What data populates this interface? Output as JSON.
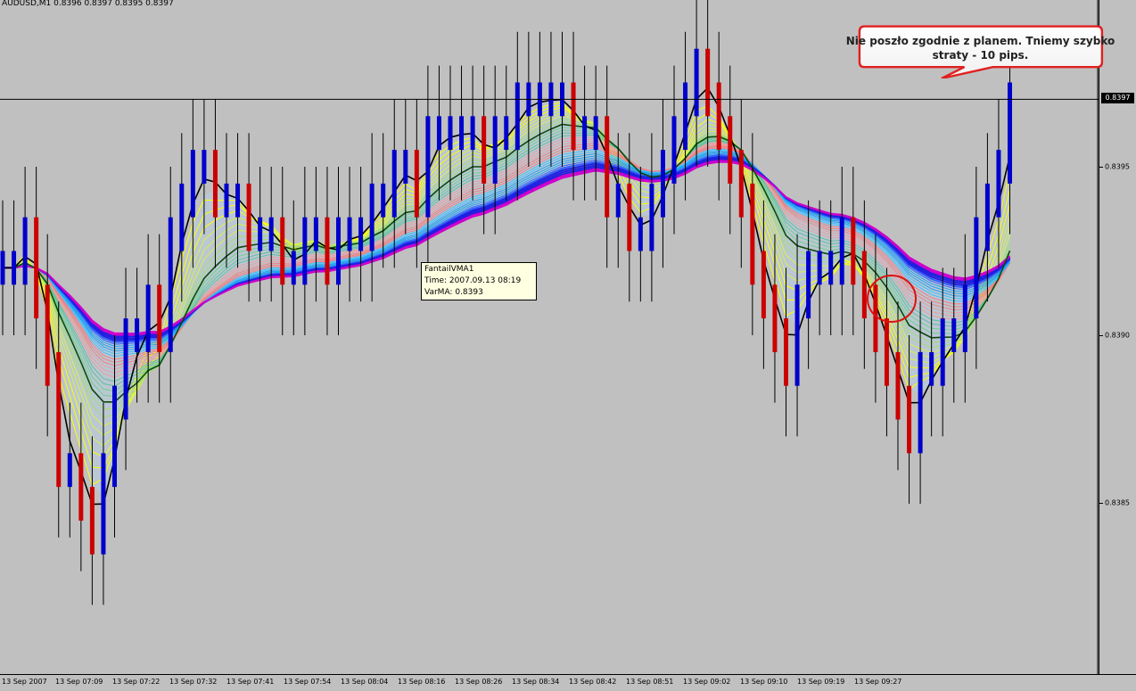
{
  "window": {
    "symbol_header": "AUDUSD,M1  0.8396 0.8397 0.8395 0.8397"
  },
  "price_scale": {
    "labels": [
      "0.8395",
      "0.8390",
      "0.8385"
    ],
    "current_price": "0.8397"
  },
  "time_axis": {
    "labels": [
      "13 Sep 2007",
      "13 Sep 07:09",
      "13 Sep 07:22",
      "13 Sep 07:32",
      "13 Sep 07:41",
      "13 Sep 07:54",
      "13 Sep 08:04",
      "13 Sep 08:16",
      "13 Sep 08:26",
      "13 Sep 08:34",
      "13 Sep 08:42",
      "13 Sep 08:51",
      "13 Sep 09:02",
      "13 Sep 09:10",
      "13 Sep 09:19",
      "13 Sep 09:27"
    ]
  },
  "tooltip": {
    "name": "FantailVMA1",
    "time": "Time: 2007.09.13 08:19",
    "value": "VarMA: 0.8393"
  },
  "callout": {
    "text": "Nie poszło zgodnie z planem. Tniemy szybko straty - 10 pips."
  },
  "colors": {
    "background": "#c0c0c0",
    "bull_candle": "#0000cc",
    "bear_candle": "#cc0000",
    "callout_border": "#e02020",
    "highlight_circle": "#dd1111"
  },
  "chart_data": {
    "type": "candlestick",
    "symbol": "AUDUSD",
    "timeframe": "M1",
    "ylim": [
      0.838,
      0.8399
    ],
    "current_price": 0.8397,
    "series": [
      {
        "closes": [
          0.8392,
          0.8392,
          0.8393,
          0.8391,
          0.8389,
          0.8386,
          0.8386,
          0.8385,
          0.8384,
          0.8386,
          0.8388,
          0.839,
          0.839,
          0.8391,
          0.839,
          0.8393,
          0.8394,
          0.8395,
          0.8395,
          0.8394,
          0.8394,
          0.8394,
          0.8393,
          0.8393,
          0.8393,
          0.8392,
          0.8392,
          0.8393,
          0.8393,
          0.8392,
          0.8393,
          0.8393,
          0.8393,
          0.8394,
          0.8394,
          0.8395,
          0.8395,
          0.8394,
          0.8396,
          0.8396,
          0.8396,
          0.8396,
          0.8396,
          0.8395,
          0.8396,
          0.8396,
          0.8397,
          0.8397,
          0.8397,
          0.8397,
          0.8397,
          0.8396,
          0.8396,
          0.8396,
          0.8394,
          0.8394,
          0.8393,
          0.8393,
          0.8394,
          0.8395,
          0.8396,
          0.8397,
          0.8398,
          0.8397,
          0.8396,
          0.8395,
          0.8394,
          0.8392,
          0.8391,
          0.839,
          0.8389,
          0.8391,
          0.8392,
          0.8392,
          0.8392,
          0.8393,
          0.8392,
          0.8391,
          0.839,
          0.8389,
          0.8388,
          0.8387,
          0.8389,
          0.8389,
          0.839,
          0.839,
          0.8391,
          0.8393,
          0.8394,
          0.8395,
          0.8397
        ]
      }
    ]
  }
}
